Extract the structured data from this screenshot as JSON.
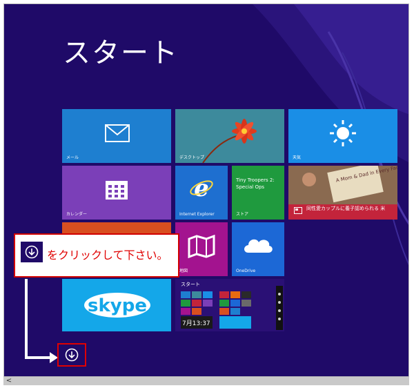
{
  "page": {
    "title": "スタート"
  },
  "tiles": {
    "mail": {
      "label": "メール"
    },
    "desktop": {
      "label": "デスクトップ"
    },
    "weather": {
      "label": "天気"
    },
    "calendar": {
      "label": "カレンダー"
    },
    "ie": {
      "label": "Internet Explorer"
    },
    "store": {
      "title": "Tiny Troopers 2: Special Ops",
      "label": "ストア"
    },
    "news": {
      "headline": "同性愛カップルに養子認められる 米",
      "sign_text": "A Mom & Dad in Every Family"
    },
    "photos": {
      "label": "地図"
    },
    "onedrive": {
      "label": "OneDrive"
    },
    "skype": {
      "logo": "skype"
    },
    "screenshot": {
      "label": "スタート",
      "clock": "7月13:37"
    }
  },
  "callout": {
    "text": "をクリックして下さい。"
  },
  "colors": {
    "background": "#1f0a68",
    "callout_border": "#d10000",
    "callout_text": "#e00000"
  }
}
